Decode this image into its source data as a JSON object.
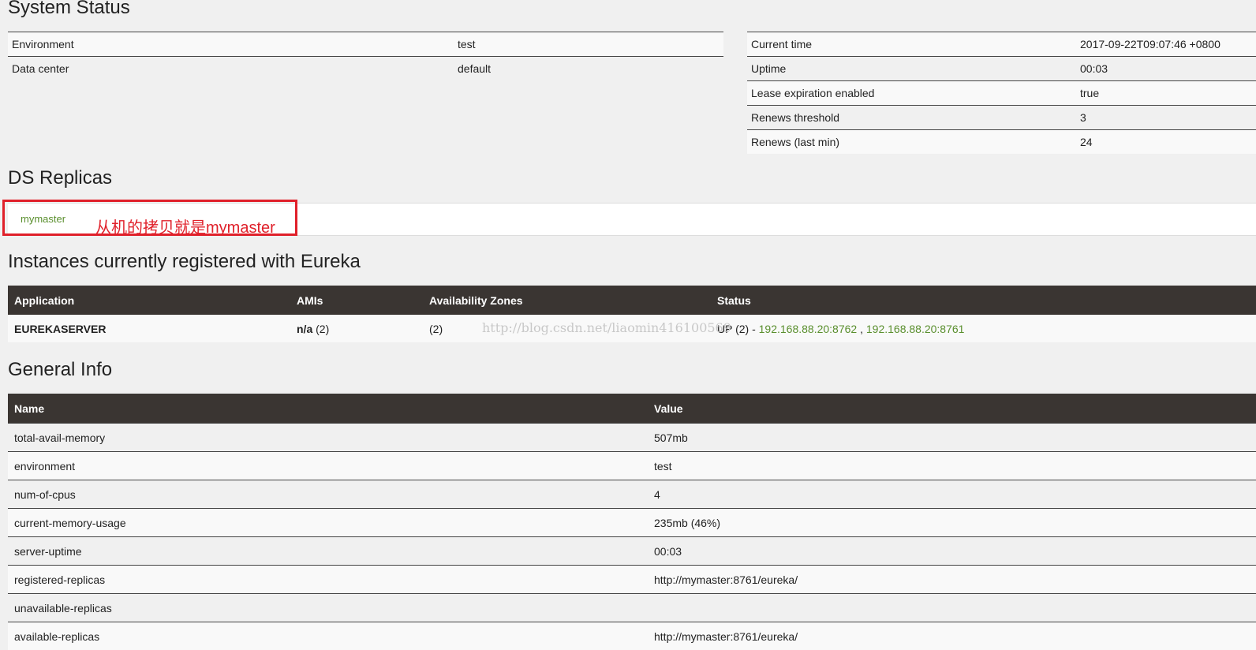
{
  "system_status": {
    "title": "System Status",
    "left_rows": [
      {
        "name": "Environment",
        "value": "test"
      },
      {
        "name": "Data center",
        "value": "default"
      }
    ],
    "right_rows": [
      {
        "name": "Current time",
        "value": "2017-09-22T09:07:46 +0800"
      },
      {
        "name": "Uptime",
        "value": "00:03"
      },
      {
        "name": "Lease expiration enabled",
        "value": "true"
      },
      {
        "name": "Renews threshold",
        "value": "3"
      },
      {
        "name": "Renews (last min)",
        "value": "24"
      }
    ]
  },
  "ds_replicas": {
    "title": "DS Replicas",
    "items": [
      "mymaster"
    ],
    "annotation": "从机的拷贝就是mymaster"
  },
  "instances": {
    "title": "Instances currently registered with Eureka",
    "headers": [
      "Application",
      "AMIs",
      "Availability Zones",
      "Status"
    ],
    "rows": [
      {
        "application": "EUREKASERVER",
        "amis_bold": "n/a",
        "amis_count": "(2)",
        "zones": "(2)",
        "status_prefix": "UP (2) -",
        "links": [
          "192.168.88.20:8762",
          "192.168.88.20:8761"
        ],
        "separator": ","
      }
    ]
  },
  "watermark": "http://blog.csdn.net/liaomin416100569",
  "general_info": {
    "title": "General Info",
    "headers": [
      "Name",
      "Value"
    ],
    "rows": [
      {
        "name": "total-avail-memory",
        "value": "507mb"
      },
      {
        "name": "environment",
        "value": "test"
      },
      {
        "name": "num-of-cpus",
        "value": "4"
      },
      {
        "name": "current-memory-usage",
        "value": "235mb (46%)"
      },
      {
        "name": "server-uptime",
        "value": "00:03"
      },
      {
        "name": "registered-replicas",
        "value": "http://mymaster:8761/eureka/"
      },
      {
        "name": "unavailable-replicas",
        "value": ""
      },
      {
        "name": "available-replicas",
        "value": "http://mymaster:8761/eureka/"
      }
    ]
  },
  "colors": {
    "page_bg": "#f0f0f0",
    "table_header_bg": "#3a3532",
    "link_green": "#5a8f2e",
    "annotation_red": "#e0202a"
  }
}
